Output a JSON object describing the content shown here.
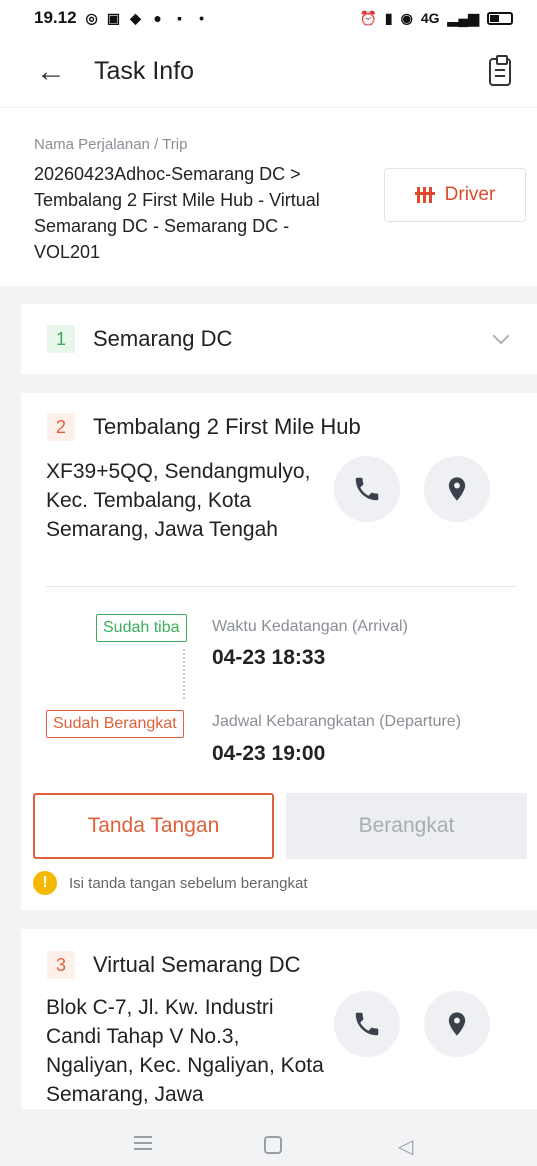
{
  "status_bar": {
    "time": "19.12",
    "signal_text": "4G"
  },
  "header": {
    "title": "Task Info"
  },
  "trip": {
    "label": "Nama Perjalanan / Trip",
    "value": "20260423Adhoc-Semarang DC > Tembalang 2 First Mile Hub - Virtual Semarang DC - Semarang DC - VOL201",
    "driver_button": "Driver"
  },
  "stops": [
    {
      "number": "1",
      "name": "Semarang DC"
    },
    {
      "number": "2",
      "name": "Tembalang 2 First Mile Hub",
      "address": "XF39+5QQ, Sendangmulyo, Kec. Tembalang, Kota Semarang, Jawa Tengah",
      "arrival_badge": "Sudah tiba",
      "arrival_label": "Waktu Kedatangan (Arrival)",
      "arrival_value": "04-23 18:33",
      "departure_badge": "Sudah Berangkat",
      "departure_label": "Jadwal Kebarangkatan (Departure)",
      "departure_value": "04-23 19:00",
      "sign_button": "Tanda Tangan",
      "depart_button": "Berangkat",
      "warning_icon": "!",
      "warning": "Isi tanda tangan sebelum berangkat"
    },
    {
      "number": "3",
      "name": "Virtual Semarang DC",
      "address": "Blok C-7, Jl. Kw. Industri Candi Tahap V No.3, Ngaliyan, Kec. Ngaliyan, Kota Semarang, Jawa"
    }
  ],
  "icons": {
    "back": "arrow-left",
    "clipboard": "clipboard",
    "phone": "phone",
    "location": "map-pin",
    "chevron": "chevron-down"
  },
  "colors": {
    "accent": "#e0603a",
    "success": "#3cae5f",
    "warning": "#f5b800"
  }
}
